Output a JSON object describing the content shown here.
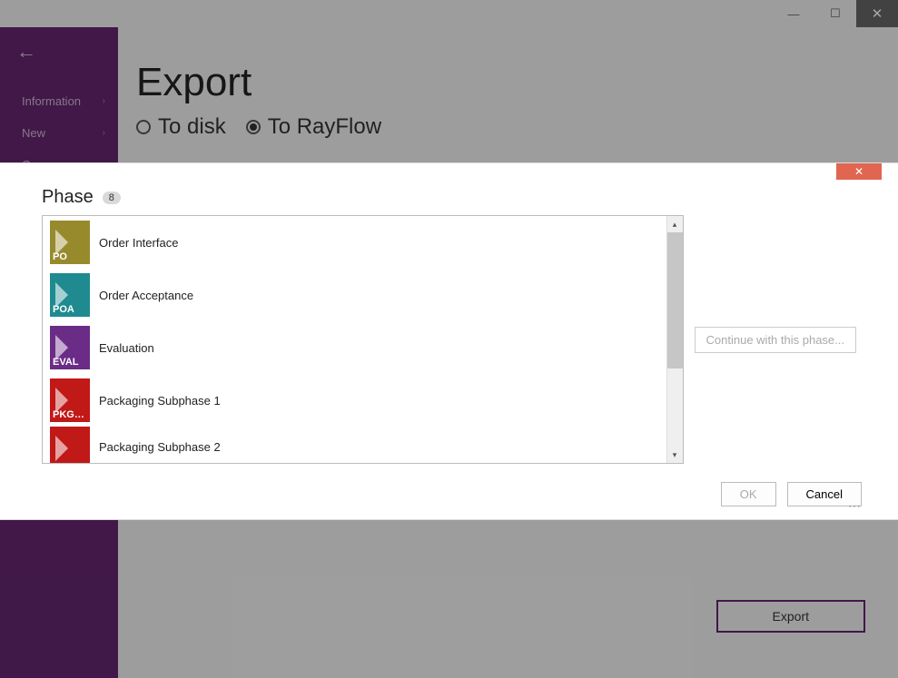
{
  "titlebar": {
    "minimize_glyph": "—",
    "maximize_glyph": "☐",
    "close_glyph": "✕"
  },
  "sidebar": {
    "items": [
      {
        "label": "Information",
        "has_chevron": true
      },
      {
        "label": "New",
        "has_chevron": true
      },
      {
        "label": "Open",
        "has_chevron": false
      }
    ]
  },
  "page": {
    "title": "Export",
    "radio_disk": "To disk",
    "radio_rayflow": "To RayFlow",
    "export_button": "Export"
  },
  "dialog": {
    "header_label": "Phase",
    "count": "8",
    "continue_label": "Continue with this phase...",
    "ok_label": "OK",
    "cancel_label": "Cancel",
    "phases": [
      {
        "code": "PO",
        "label": "Order Interface",
        "color": "#978a2d"
      },
      {
        "code": "POA",
        "label": "Order Acceptance",
        "color": "#1f8a8f"
      },
      {
        "code": "EVAL",
        "label": "Evaluation",
        "color": "#6a2c86"
      },
      {
        "code": "PKG…",
        "label": "Packaging Subphase 1",
        "color": "#c11818"
      },
      {
        "code": "",
        "label": "Packaging Subphase 2",
        "color": "#c11818"
      }
    ]
  }
}
